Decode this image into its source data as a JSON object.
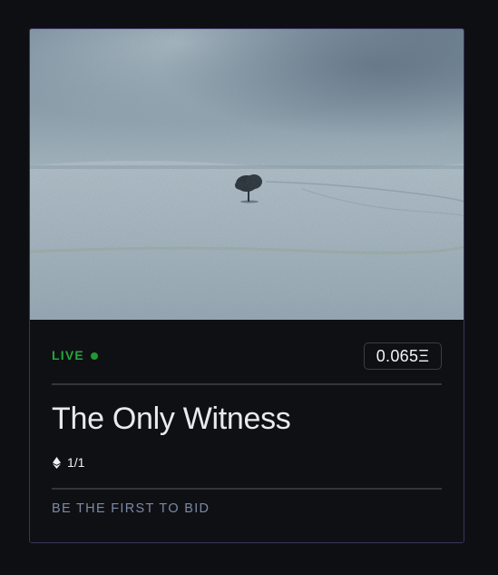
{
  "card": {
    "status_label": "LIVE",
    "price": "0.065Ξ",
    "title": "The Only Witness",
    "edition": "1/1",
    "bid_prompt": "BE THE FIRST TO BID"
  },
  "icons": {
    "status": "live-dot-icon",
    "edition": "ethereum-icon"
  },
  "colors": {
    "background": "#0e0f12",
    "card_border": "#3a3560",
    "live_accent": "#23a83a",
    "title_text": "#e9eaee",
    "muted_text": "#7a8aa6"
  }
}
